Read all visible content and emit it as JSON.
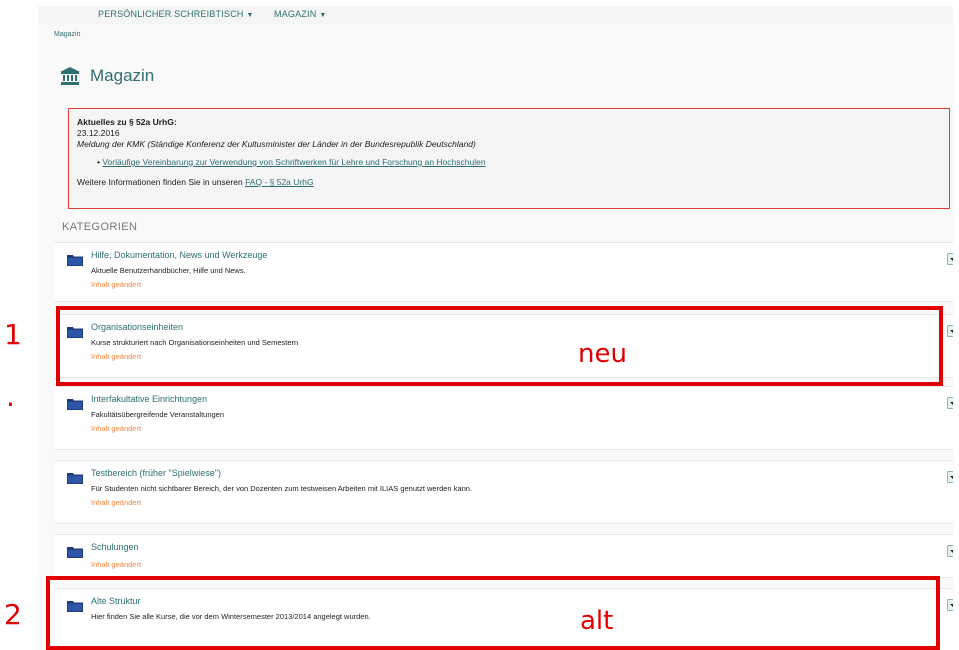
{
  "topnav": {
    "desk_label": "PERSÖNLICHER SCHREIBTISCH",
    "magazin_label": "MAGAZIN"
  },
  "breadcrumb": "Magazin",
  "page_title": "Magazin",
  "notice": {
    "title": "Aktuelles zu § 52a UrhG:",
    "date": "23.12.2016",
    "meldung": "Meldung der KMK (Ständige Konferenz der Kultusminister der Länder in der Bundesrepublik Deutschland)",
    "link": "Vorläufige Vereinbarung zur Verwendung von Schriftwerken für Lehre und Forschung an Hochschulen",
    "more_prefix": "Weitere Informationen finden Sie in unseren",
    "more_link": "FAQ - § 52a UrhG"
  },
  "categories_header": "KATEGORIEN",
  "categories": [
    {
      "title": "Hilfe, Dokumentation, News und Werkzeuge",
      "desc": "Aktuelle Benutzerhandbücher, Hilfe und News.",
      "changed": "Inhalt geändert"
    },
    {
      "title": "Organisationseinheiten",
      "desc": "Kurse strukturiert nach Organisationseinheiten und Semestern",
      "changed": "Inhalt geändert"
    },
    {
      "title": "Interfakultative Einrichtungen",
      "desc": "Fakultätsübergreifende Veranstaltungen",
      "changed": "Inhalt geändert"
    },
    {
      "title": "Testbereich (früher \"Spielwiese\")",
      "desc": "Für Studenten nicht sichtbarer Bereich, der von Dozenten zum testweisen Arbeiten mit ILIAS genutzt werden kann.",
      "changed": "Inhalt geändert"
    },
    {
      "title": "Schulungen",
      "desc": "",
      "changed": "Inhalt geändert"
    },
    {
      "title": "Alte Struktur",
      "desc": "Hier finden Sie alle Kurse, die vor dem Wintersemester 2013/2014 angelegt wurden.",
      "changed": ""
    }
  ],
  "annotations": {
    "num1": "1",
    "num2": "2",
    "dot": ".",
    "neu": "neu",
    "alt": "alt",
    "color": "#e00000"
  },
  "colors": {
    "accent": "#2e6f72",
    "changed": "#f08540",
    "notice_border": "#e03a3a"
  }
}
